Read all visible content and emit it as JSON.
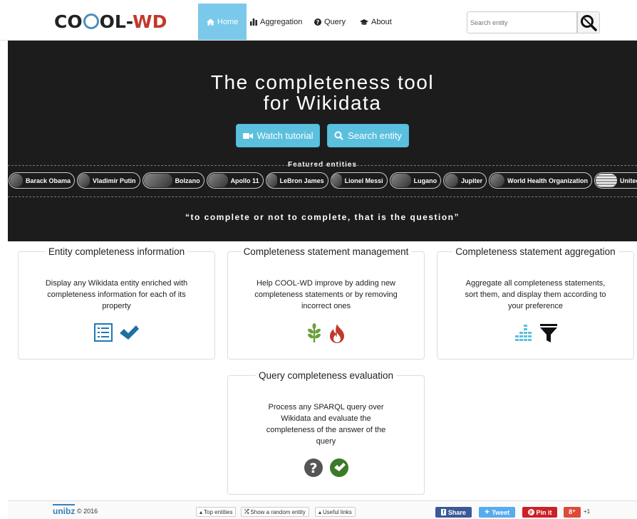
{
  "header": {
    "logo_prefix": "CO",
    "logo_middle": "OL-",
    "logo_suffix": "WD",
    "nav": [
      {
        "label": "Home",
        "icon": "home-icon"
      },
      {
        "label": "Aggregation",
        "icon": "bar-chart-icon"
      },
      {
        "label": "Query",
        "icon": "question-circle-icon"
      },
      {
        "label": "About",
        "icon": "graduation-cap-icon"
      }
    ],
    "search_placeholder": "Search entity"
  },
  "hero": {
    "title_line1": "The completeness tool",
    "title_line2": "for Wikidata",
    "watch_tutorial": "Watch tutorial",
    "search_entity": "Search entity",
    "featured_label": "Featured entities",
    "featured": [
      "Barack Obama",
      "Vladimir Putin",
      "Bolzano",
      "Apollo 11",
      "LeBron James",
      "Lionel Messi",
      "Lugano",
      "Jupiter",
      "World Health Organization",
      "United States"
    ],
    "quote": "“to complete or not to complete, that is the question”"
  },
  "cards": {
    "entity": {
      "title": "Entity completeness information",
      "text": "Display any Wikidata entity enriched with completeness information for each of its property"
    },
    "statement": {
      "title": "Completeness statement management",
      "text": "Help COOL-WD improve by adding new completeness statements or by removing incorrect ones"
    },
    "aggregation": {
      "title": "Completeness statement aggregation",
      "text": "Aggregate all completeness statements, sort them, and display them according to your preference"
    },
    "query": {
      "title": "Query completeness evaluation",
      "text": "Process any SPARQL query over Wikidata and evaluate the completeness of the answer of the query"
    }
  },
  "footer": {
    "unibz": "unibz",
    "copyright": "© 2016",
    "top_entities": "Top entities",
    "random_entity": "Show a random entity",
    "useful_links": "Useful links",
    "share": "Share",
    "tweet": "Tweet",
    "pin": "Pin it",
    "gplus": "8⁺",
    "gplus_count": "+1"
  },
  "colors": {
    "accent": "#5bc0de",
    "hero_bg": "#1c1c1c",
    "facebook": "#3b5998",
    "twitter": "#55acee",
    "pinterest": "#cb2027",
    "gplus": "#dd4b39"
  }
}
